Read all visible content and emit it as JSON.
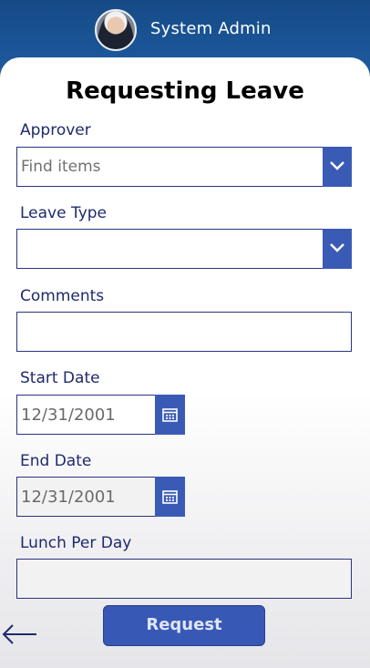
{
  "header": {
    "user_name": "System Admin"
  },
  "form": {
    "title": "Requesting Leave",
    "approver": {
      "label": "Approver",
      "placeholder": "Find items",
      "value": ""
    },
    "leave_type": {
      "label": "Leave Type",
      "value": ""
    },
    "comments": {
      "label": "Comments",
      "value": ""
    },
    "start_date": {
      "label": "Start Date",
      "value": "12/31/2001"
    },
    "end_date": {
      "label": "End Date",
      "value": "12/31/2001"
    },
    "lunch_per_day": {
      "label": "Lunch Per Day",
      "value": ""
    },
    "submit_label": "Request"
  },
  "icons": {
    "dropdown": "chevron-down-icon",
    "calendar": "calendar-icon",
    "back": "back-arrow-icon"
  },
  "colors": {
    "header_bg": "#1e5a9e",
    "accent": "#3a5bb5",
    "field_border": "#2b3480",
    "label_text": "#1e2a6b"
  }
}
